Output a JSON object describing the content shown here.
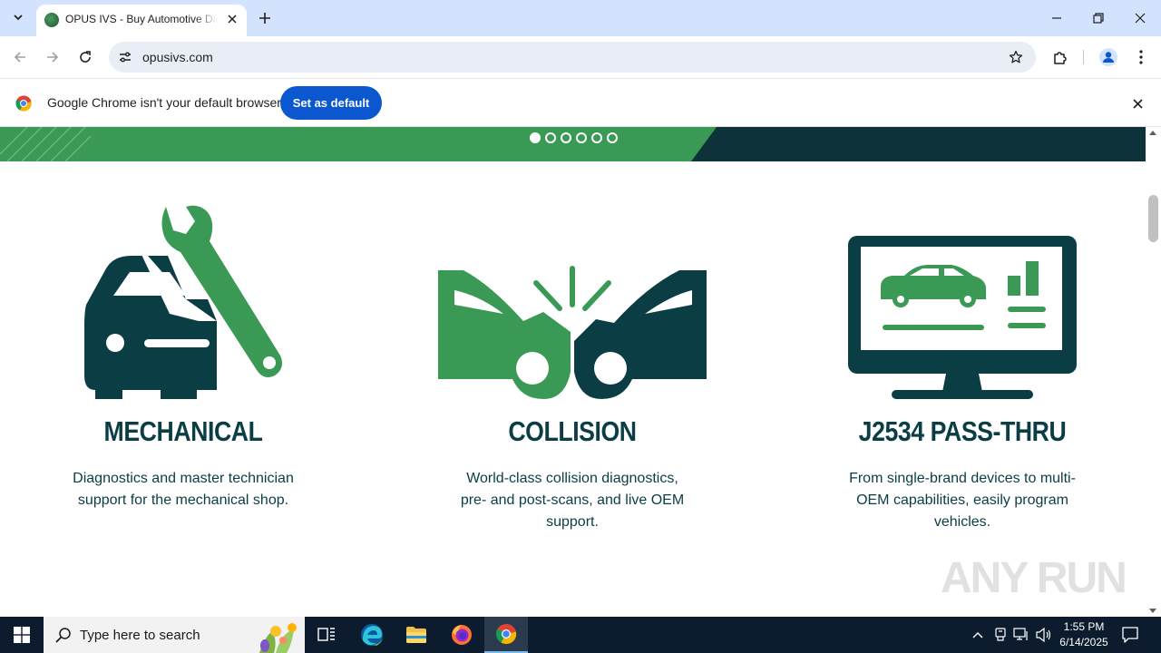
{
  "browser": {
    "tab_title": "OPUS IVS - Buy Automotive Diagnostic Tools",
    "url": "opusivs.com"
  },
  "infobar": {
    "message": "Google Chrome isn't your default browser",
    "button": "Set as default"
  },
  "carousel": {
    "dot_count": 6,
    "active_index": 0
  },
  "features": [
    {
      "title": "MECHANICAL",
      "description": "Diagnostics and master technician support for the mechanical shop.",
      "icon": "car-wrench-icon"
    },
    {
      "title": "COLLISION",
      "description": "World-class collision diagnostics, pre- and post-scans, and live OEM support.",
      "icon": "collision-cars-icon"
    },
    {
      "title": "J2534 PASS-THRU",
      "description": "From single-brand devices to multi-OEM capabilities, easily program vehicles.",
      "icon": "monitor-car-icon"
    }
  ],
  "watermark": "ANY RUN",
  "taskbar": {
    "search_placeholder": "Type here to search",
    "time": "1:55 PM",
    "date": "6/14/2025"
  },
  "colors": {
    "brand_green": "#3a9a55",
    "brand_dark": "#0b3d45",
    "chrome_blue": "#0b57d0",
    "tab_strip": "#d3e3fd"
  }
}
